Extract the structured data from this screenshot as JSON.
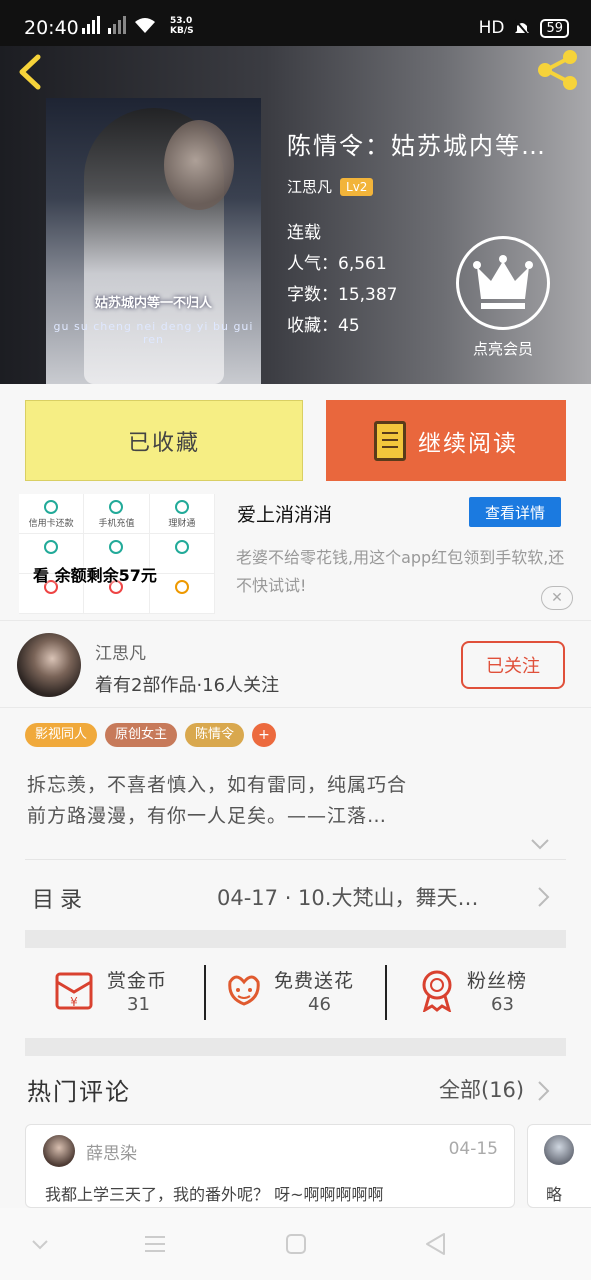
{
  "status_bar": {
    "time": "20:40",
    "net_speed_value": "53.0",
    "net_speed_unit": "KB/S",
    "hd": "HD",
    "battery": "59"
  },
  "book": {
    "title": "陈情令：姑苏城内等…",
    "author": "江思凡",
    "level": "Lv2",
    "status": "连载",
    "popularity": "人气：6,561",
    "words": "字数：15,387",
    "collections": "收藏：45",
    "cover_caption": "姑苏城内等一不归人",
    "cover_pinyin": "gu su cheng nei deng yi bu gui ren",
    "vip_label": "点亮会员"
  },
  "actions": {
    "collected_label": "已收藏",
    "continue_label": "继续阅读"
  },
  "ad": {
    "title": "爱上消消消",
    "detail_button": "查看详情",
    "description": "老婆不给零花钱,用这个app红包领到手软软,还不快试试!",
    "close_symbol": "✕",
    "image_overlay": "看 余额剩余57元",
    "grid_items": [
      "信用卡还款",
      "手机充值",
      "理财通",
      "",
      "",
      "",
      "",
      "",
      ""
    ]
  },
  "author_card": {
    "name": "江思凡",
    "info": "着有2部作品·16人关注",
    "follow_label": "已关注"
  },
  "tags": [
    {
      "label": "影视同人",
      "color": "#f0a93b"
    },
    {
      "label": "原创女主",
      "color": "#c77a5a"
    },
    {
      "label": "陈情令",
      "color": "#d9a84e"
    }
  ],
  "tag_more": "+",
  "intro": {
    "line1": "拆忘羡，不喜者慎入，如有雷同，纯属巧合",
    "line2": "前方路漫漫，有你一人足矣。——江落…"
  },
  "toc": {
    "label": "目录",
    "latest": "04-17 · 10.大梵山，舞天…"
  },
  "stats": [
    {
      "label": "赏金币",
      "value": "31",
      "icon": "red-envelope-icon"
    },
    {
      "label": "免费送花",
      "value": "46",
      "icon": "flower-icon"
    },
    {
      "label": "粉丝榜",
      "value": "63",
      "icon": "medal-icon"
    }
  ],
  "hot_comments": {
    "title": "热门评论",
    "all_label": "全部(16)",
    "items": [
      {
        "user": "薛思染",
        "date": "04-15",
        "text": "我都上学三天了，我的番外呢？ 呀~啊啊啊啊啊"
      },
      {
        "user": "",
        "date": "",
        "text": "略"
      }
    ]
  },
  "colors": {
    "accent_orange": "#e9673d",
    "collected_yellow": "#f6ee84",
    "follow_red": "#e0503a",
    "ad_blue": "#1b7ae0",
    "share_yellow": "#f6d33a"
  }
}
